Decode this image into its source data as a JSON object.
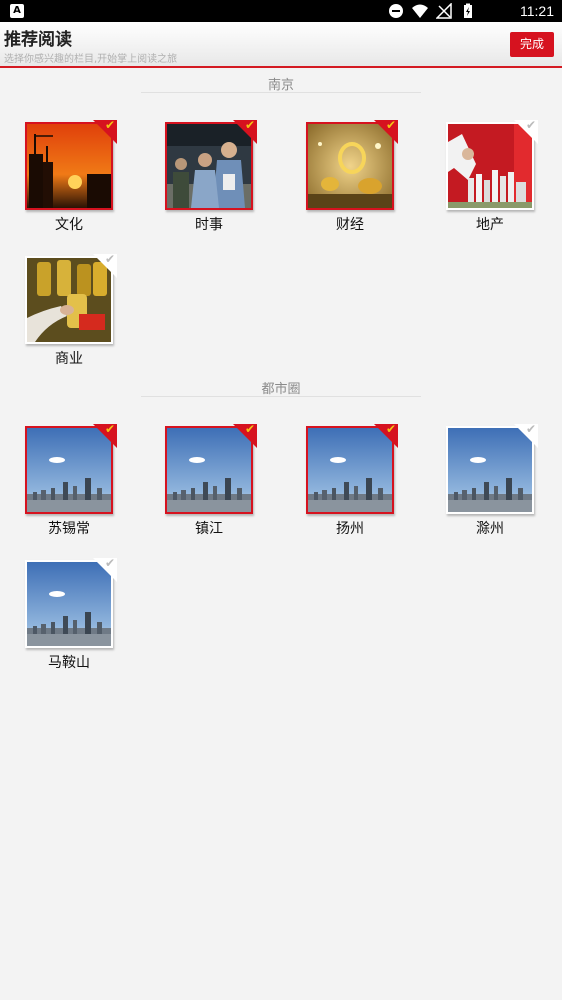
{
  "status_bar": {
    "time": "11:21",
    "app_glyph": "A"
  },
  "header": {
    "title": "推荐阅读",
    "subtitle": "选择你感兴趣的栏目,开始掌上阅读之旅",
    "done_label": "完成"
  },
  "colors": {
    "accent": "#d6121f",
    "check": "#f3c413"
  },
  "check_glyph": "✔",
  "sections": [
    {
      "title": "南京",
      "tiles": [
        {
          "label": "文化",
          "selected": true,
          "image": "sunset-skyline"
        },
        {
          "label": "时事",
          "selected": true,
          "image": "police-officers"
        },
        {
          "label": "财经",
          "selected": true,
          "image": "gold-jewelry"
        },
        {
          "label": "地产",
          "selected": false,
          "image": "real-estate"
        },
        {
          "label": "商业",
          "selected": false,
          "image": "oil-bottles"
        }
      ]
    },
    {
      "title": "都市圈",
      "tiles": [
        {
          "label": "苏锡常",
          "selected": true,
          "image": "city-skyline"
        },
        {
          "label": "镇江",
          "selected": true,
          "image": "city-skyline"
        },
        {
          "label": "扬州",
          "selected": true,
          "image": "city-skyline"
        },
        {
          "label": "滁州",
          "selected": false,
          "image": "city-skyline"
        },
        {
          "label": "马鞍山",
          "selected": false,
          "image": "city-skyline"
        }
      ]
    }
  ]
}
